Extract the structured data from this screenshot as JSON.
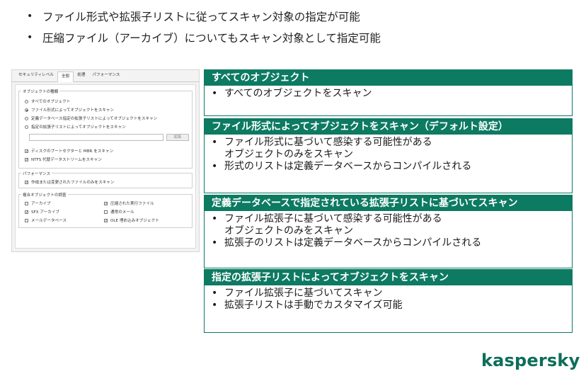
{
  "header_bullets": [
    "ファイル形式や拡張子リストに従ってスキャン対象の指定が可能",
    "圧縮ファイル（アーカイブ）についてもスキャン対象として指定可能"
  ],
  "settings_dialog": {
    "tabs": [
      {
        "label": "セキュリティレベル",
        "active": false
      },
      {
        "label": "全般",
        "active": true
      },
      {
        "label": "処理",
        "active": false
      },
      {
        "label": "パフォーマンス",
        "active": false
      }
    ],
    "object_group": {
      "label": "オブジェクトの種類",
      "radios": [
        {
          "label": "すべてのオブジェクト",
          "selected": false
        },
        {
          "label": "ファイル形式によってオブジェクトをスキャン",
          "selected": true
        },
        {
          "label": "定義データベース指定の拡張子リストによってオブジェクトをスキャン",
          "selected": false
        },
        {
          "label": "指定の拡張子リストによってオブジェクトをスキャン",
          "selected": false
        }
      ],
      "edit_button": "編集",
      "checkboxes": [
        {
          "label": "ディスクのブートセクターと MBR をスキャン",
          "checked": true
        },
        {
          "label": "NTFS 代替データストリームをスキャン",
          "checked": true
        }
      ]
    },
    "performance_group": {
      "label": "パフォーマンス",
      "checkboxes": [
        {
          "label": "作成または変更されたファイルのみをスキャン",
          "checked": true
        }
      ]
    },
    "compound_group": {
      "label": "複合オブジェクトの調査",
      "left": [
        {
          "label": "アーカイブ",
          "checked": false
        },
        {
          "label": "SFX アーカイブ",
          "checked": true
        },
        {
          "label": "メールデータベース",
          "checked": false
        }
      ],
      "right": [
        {
          "label": "圧縮された実行ファイル",
          "checked": true
        },
        {
          "label": "通常のメール",
          "checked": false
        },
        {
          "label": "OLE 埋め込みオブジェクト",
          "checked": true
        }
      ]
    }
  },
  "boxes": [
    {
      "title": "すべてのオブジェクト",
      "bullets": [
        "すべてのオブジェクトをスキャン"
      ]
    },
    {
      "title": "ファイル形式によってオブジェクトをスキャン（デフォルト設定）",
      "bullets": [
        "ファイル形式に基づいて感染する可能性がある\nオブジェクトのみをスキャン",
        "形式のリストは定義データベースからコンパイルされる"
      ]
    },
    {
      "title": "定義データベースで指定されている拡張子リストに基づいてスキャン",
      "bullets": [
        "ファイル拡張子に基づいて感染する可能性がある\nオブジェクトのみをスキャン",
        "拡張子のリストは定義データベースからコンパイルされる"
      ]
    },
    {
      "title": "指定の拡張子リストによってオブジェクトをスキャン",
      "bullets": [
        "ファイル拡張子に基づいてスキャン",
        "拡張子リストは手動でカスタマイズ可能"
      ]
    }
  ],
  "logo_text": "kaspersky",
  "colors": {
    "accent": "#0d7a62",
    "logo": "#0d6e59"
  }
}
